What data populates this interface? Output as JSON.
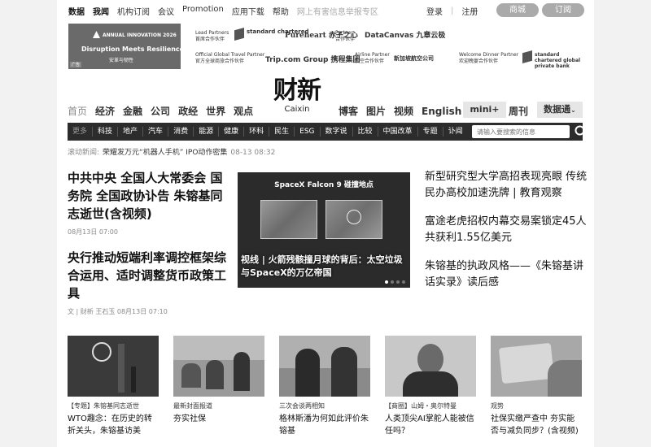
{
  "top_nav": [
    "数据",
    "我闻",
    "机构订阅",
    "会议",
    "Promotion",
    "应用下载",
    "帮助",
    "网上有害信息举报专区"
  ],
  "top_links": {
    "login": "登录",
    "sep": "|",
    "register": "注册",
    "mall": "商城",
    "subscribe": "订阅"
  },
  "ads": {
    "main": {
      "brand": "ANNUAL INNOVATION 2026",
      "line1": "Disruption Meets Resilience",
      "line2": "安革与韧性",
      "tag": "广告"
    },
    "sponsors": [
      {
        "en": "Lead Partners",
        "cn": "首席合作伙伴",
        "logo": "standard chartered"
      },
      {
        "en": "",
        "cn": "",
        "logo": "Pureheart 赤子之心"
      },
      {
        "en": "Partner",
        "cn": "合作伙伴",
        "logo": "DataCanvas 九章云极"
      },
      {
        "en": "Official Global Travel Partner",
        "cn": "官方全球商旅合作伙伴",
        "logo": "Trip.com Group 携程集团"
      },
      {
        "en": "Airline Partner",
        "cn": "航空合作伙伴",
        "logo": "新加坡航空公司"
      },
      {
        "en": "Welcome Dinner Partner",
        "cn": "欢迎晚宴合作伙伴",
        "logo": "standard chartered global private bank"
      }
    ]
  },
  "masthead": {
    "cn": "财新",
    "en": "Caixin"
  },
  "main_nav": [
    "首页",
    "经济",
    "金融",
    "公司",
    "政经",
    "世界",
    "观点"
  ],
  "right_nav": [
    "博客",
    "图片",
    "视频",
    "English"
  ],
  "mini": "mini+",
  "weekly": "周刊",
  "data_dropdown": "数据通",
  "sub_nav": [
    "更多",
    "科技",
    "地产",
    "汽车",
    "消费",
    "能源",
    "健康",
    "环科",
    "民生",
    "ESG",
    "数字说",
    "比较",
    "中国改革",
    "专题",
    "讣闻"
  ],
  "search": {
    "placeholder": "请输入要搜索的信息"
  },
  "ticker": {
    "label": "滚动新闻:",
    "title": "荣耀发万元“机器人手机” IPO动作密集",
    "time": "08-13 08:32"
  },
  "lead_stories": [
    {
      "title": "中共中央 全国人大常委会 国务院 全国政协讣告 朱镕基同志逝世(含视频)",
      "meta": "08月13日 07:00"
    },
    {
      "title": "央行推动短端利率调控框架综合运用、适时调整货币政策工具",
      "meta": "文 | 财新 王石玉 08月13日 07:10"
    }
  ],
  "feature": {
    "header": "SpaceX Falcon 9 碰撞地点",
    "caption": "视线 | 火箭残骸撞月球的背后：太空垃圾与SpaceX的万亿帝国"
  },
  "right_stories": [
    "新型研究型大学高招表现亮眼 传统民办高校加速洗牌 | 教育观察",
    "富途老虎招权内幕交易案锁定45人 共获利1.55亿美元",
    "朱镕基的执政风格——《朱镕基讲话实录》读后感"
  ],
  "cards": [
    {
      "kicker": "【专题】朱镕基同志逝世",
      "title": "WTO趣念：在历史的转折关头，朱镕基访美"
    },
    {
      "kicker": "最新封面报道",
      "title": "夯实社保"
    },
    {
      "kicker": "三次会谈两相知",
      "title": "格林斯潘为何如此评价朱镕基"
    },
    {
      "kicker": "【商圈】山姆・奥尔特曼",
      "title": "人类顶尖AI掌舵人能被信任吗？"
    },
    {
      "kicker": "观势",
      "title": "社保实缴严查中 夯实能否与减负同步？(含视频)"
    }
  ]
}
